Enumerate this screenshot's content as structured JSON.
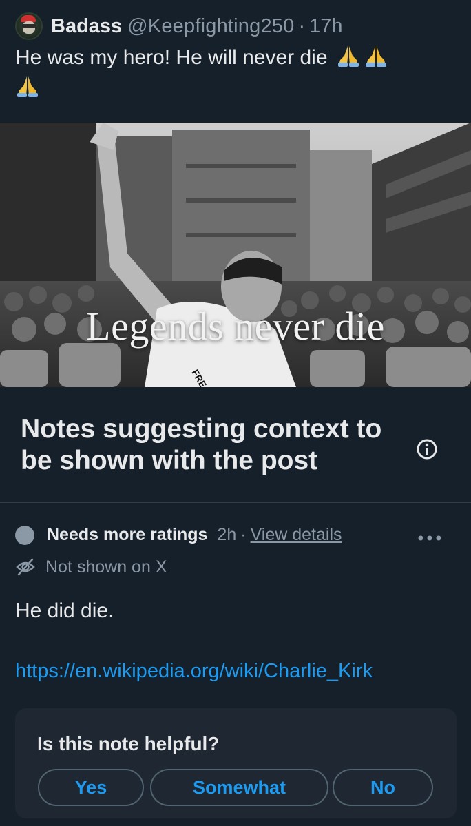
{
  "post": {
    "display_name": "Badass",
    "handle": "@Keepfighting250",
    "separator": "·",
    "time": "17h",
    "text": "He was my hero! He will never die",
    "emoji": "folded-hands",
    "image": {
      "caption": "Legends never die",
      "shirt_text": "FRE",
      "tone": "black-and-white"
    }
  },
  "notes": {
    "title": "Notes suggesting context to be shown with the post",
    "info_icon": "info-icon"
  },
  "note": {
    "status": "Needs more ratings",
    "status_color": "#8b98a5",
    "time": "2h",
    "separator": "·",
    "view_details": "View details",
    "more_icon": "more-horizontal-icon",
    "visibility": "Not shown on X",
    "visibility_icon": "eye-off-icon",
    "body": "He did die.",
    "link": "https://en.wikipedia.org/wiki/Charlie_Kirk"
  },
  "helpful": {
    "question": "Is this note helpful?",
    "options": [
      "Yes",
      "Somewhat",
      "No"
    ]
  },
  "colors": {
    "background": "#16202b",
    "card": "#1e2732",
    "accent": "#1d9bf0",
    "muted": "#8b98a5",
    "text": "#e7e9ea"
  }
}
